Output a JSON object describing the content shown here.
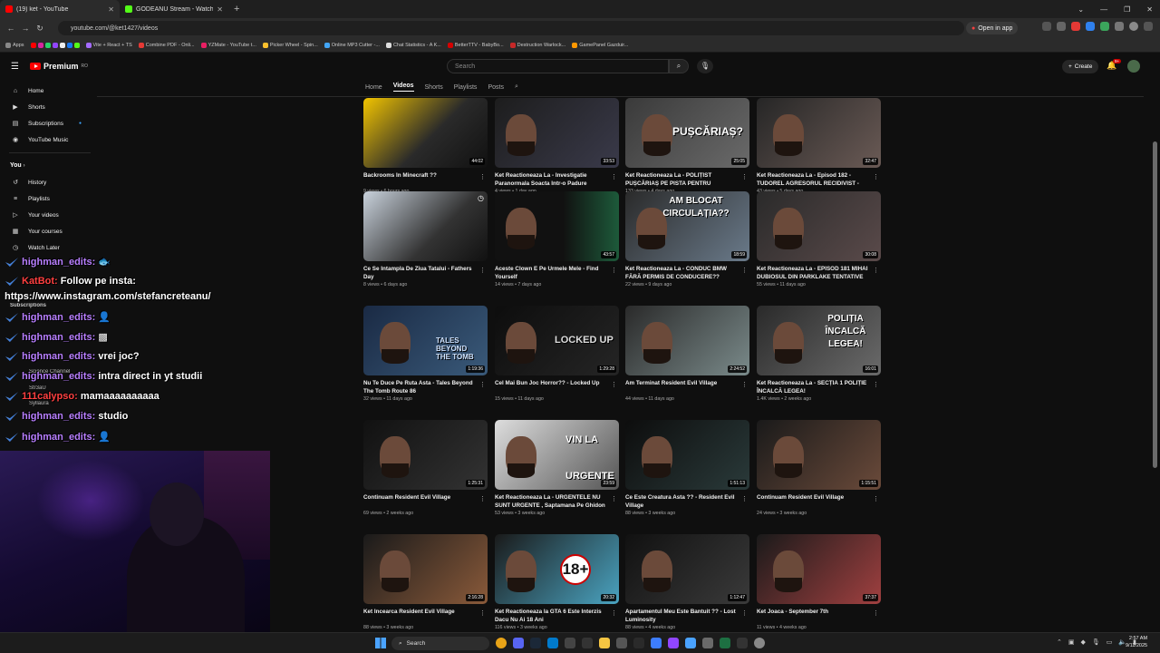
{
  "browser": {
    "tabs": [
      {
        "title": "(19) ket - YouTube",
        "color": "#ff0000",
        "close": "✕"
      },
      {
        "title": "GODEANU Stream - Watch Live",
        "color": "#53fc18",
        "close": "✕"
      }
    ],
    "new_tab": "+",
    "url": "youtube.com/@ket1427/videos",
    "open_in_app": "Open in app",
    "bookmarks": [
      "Apps",
      "Vite + React + TS",
      "Combine PDF - Onli...",
      "YZMate - YouTube t...",
      "Picker Wheel - Spin...",
      "Online MP3 Cutter -...",
      "Chat Statistics - A K...",
      "BetterTTV - BabyBo...",
      "Destruction Warlock...",
      "GamePanel Gazduir..."
    ]
  },
  "yt": {
    "logo_text": "Premium",
    "logo_sup": "RO",
    "search_placeholder": "Search",
    "create_label": "Create",
    "bell_badge": "9+",
    "channel_tabs": [
      "Home",
      "Videos",
      "Shorts",
      "Playlists",
      "Posts"
    ],
    "active_tab": "Videos"
  },
  "sidebar": {
    "top": [
      {
        "label": "Home",
        "icon": "⌂"
      },
      {
        "label": "Shorts",
        "icon": "▶"
      },
      {
        "label": "Subscriptions",
        "icon": "▤"
      },
      {
        "label": "YouTube Music",
        "icon": "◉"
      }
    ],
    "you_header": "You",
    "you": [
      {
        "label": "History",
        "icon": "↺"
      },
      {
        "label": "Playlists",
        "icon": "≡"
      },
      {
        "label": "Your videos",
        "icon": "▷"
      },
      {
        "label": "Your courses",
        "icon": "▦"
      },
      {
        "label": "Watch Later",
        "icon": "◷"
      }
    ],
    "subscriptions_header": "Subscriptions",
    "ghost": [
      "Science Channel",
      "Str3aU",
      "Syllaura"
    ]
  },
  "videos": [
    {
      "title": "Backrooms In Minecraft ??",
      "meta": "9 views • 6 hours ago",
      "duration": "44:02",
      "overlay": ""
    },
    {
      "title": "Ket Reactioneaza La - Investigatie Paranormala Soacta Intr-o Padure Bantuit...",
      "meta": "4 views • 1 day ago",
      "duration": "33:53",
      "overlay": ""
    },
    {
      "title": "Ket Reactioneaza La - POLIȚIST PUȘCĂRIAȘ PE PISTA PENTRU BICICLETE? | Săptămân...",
      "meta": "133 views • 4 days ago",
      "duration": "25:05",
      "overlay": "PUȘCĂRIAȘ?"
    },
    {
      "title": "Ket Reactioneaza La - Episod 182 - TUDOREL AGRESORUL RECIDIVIST - COPI...",
      "meta": "43 views • 5 days ago",
      "duration": "32:47",
      "overlay": ""
    },
    {
      "title": "Ce Se Intampla De Ziua Tatalui - Fathers Day",
      "meta": "8 views • 6 days ago",
      "duration": "",
      "overlay": ""
    },
    {
      "title": "Aceste Clown E Pe Urmele Mele - Find Yourself",
      "meta": "14 views • 7 days ago",
      "duration": "43:57",
      "overlay": ""
    },
    {
      "title": "Ket Reactioneaza La - CONDUC BMW FĂRĂ PERMIS DE CONDUCERE??",
      "meta": "22 views • 9 days ago",
      "duration": "18:59",
      "overlay": "AM BLOCAT CIRCULAȚIA??"
    },
    {
      "title": "Ket Reactioneaza La - EPISOD 181 MIHAI DUBIOSUL DIN PARKLAKE TENTATIVE DE...",
      "meta": "55 views • 11 days ago",
      "duration": "30:08",
      "overlay": ""
    },
    {
      "title": "Nu Te Duce Pe Ruta Asta - Tales Beyond The Tomb Route 86",
      "meta": "32 views • 11 days ago",
      "duration": "1:19:36",
      "overlay": "TALES BEYOND THE TOMB"
    },
    {
      "title": "Cel Mai Bun Joc Horror?? - Locked Up",
      "meta": "15 views • 11 days ago",
      "duration": "1:29:28",
      "overlay": "LOCKED UP"
    },
    {
      "title": "Am Terminat Resident Evil Village",
      "meta": "44 views • 11 days ago",
      "duration": "2:24:52",
      "overlay": ""
    },
    {
      "title": "Ket Reactioneaza La - SECȚIA 1 POLIȚIE ÎNCALCĂ LEGEA!",
      "meta": "1.4K views • 2 weeks ago",
      "duration": "16:01",
      "overlay": "POLIȚIA ÎNCALCĂ LEGEA!"
    },
    {
      "title": "Continuam Resident Evil Village",
      "meta": "69 views • 2 weeks ago",
      "duration": "1:25:31",
      "overlay": ""
    },
    {
      "title": "Ket Reactioneaza La - URGENTELE NU SUNT URGENTE , Saptamana Pe Ghidon #75",
      "meta": "53 views • 3 weeks ago",
      "duration": "23:59",
      "overlay": "VIN LA URGENTE"
    },
    {
      "title": "Ce Este Creatura Asta ?? - Resident Evil Village",
      "meta": "88 views • 3 weeks ago",
      "duration": "1:51:13",
      "overlay": ""
    },
    {
      "title": "Continuam Resident Evil Village",
      "meta": "24 views • 3 weeks ago",
      "duration": "1:15:51",
      "overlay": ""
    },
    {
      "title": "Ket Incearca Resident Evil Village",
      "meta": "88 views • 3 weeks ago",
      "duration": "2:16:28",
      "overlay": ""
    },
    {
      "title": "Ket Reactioneaza la GTA 6 Este Interzis Dacu Nu Ai 18 Ani",
      "meta": "116 views • 3 weeks ago",
      "duration": "20:32",
      "overlay": "18+"
    },
    {
      "title": "Apartamentul Meu Este Bantuit ?? - Lost Luminosity",
      "meta": "88 views • 4 weeks ago",
      "duration": "1:12:47",
      "overlay": ""
    },
    {
      "title": "Ket Joaca - September 7th",
      "meta": "11 views • 4 weeks ago",
      "duration": "37:37",
      "overlay": ""
    }
  ],
  "chat": [
    {
      "user": "highman_edits:",
      "msg": "🐟",
      "color": "purple"
    },
    {
      "user": "KatBot:",
      "msg": "Follow pe insta:",
      "color": "red"
    },
    {
      "user": "",
      "msg": "https://www.instagram.com/stefancreteanu/",
      "color": "none"
    },
    {
      "user": "highman_edits:",
      "msg": "👤",
      "color": "purple"
    },
    {
      "user": "highman_edits:",
      "msg": "▩",
      "color": "purple"
    },
    {
      "user": "highman_edits:",
      "msg": "vrei joc?",
      "color": "purple"
    },
    {
      "user": "highman_edits:",
      "msg": "intra direct in yt studii",
      "color": "purple"
    },
    {
      "user": "111calypso:",
      "msg": "mamaaaaaaaaaa",
      "color": "red"
    },
    {
      "user": "highman_edits:",
      "msg": "studio",
      "color": "purple"
    },
    {
      "user": "highman_edits:",
      "msg": "👤",
      "color": "purple"
    }
  ],
  "taskbar": {
    "search": "Search",
    "time": "2:57 AM",
    "date": "9/11/2025"
  }
}
